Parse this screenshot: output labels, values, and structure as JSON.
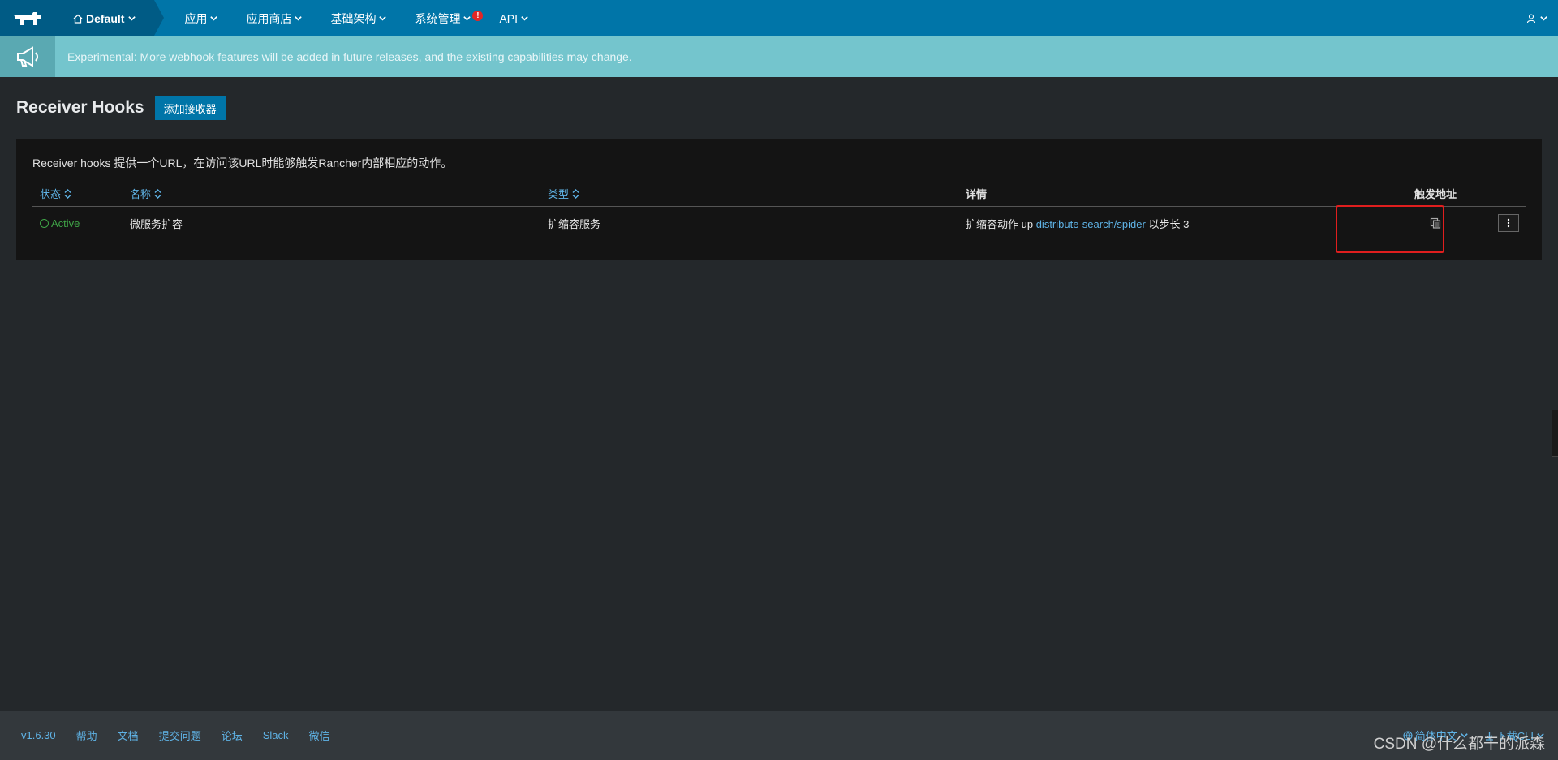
{
  "nav": {
    "env_label": "Default",
    "items": [
      {
        "label": "应用"
      },
      {
        "label": "应用商店"
      },
      {
        "label": "基础架构"
      },
      {
        "label": "系统管理",
        "alert": "!"
      },
      {
        "label": "API"
      }
    ]
  },
  "banner": {
    "text": "Experimental: More webhook features will be added in future releases, and the existing capabilities may change."
  },
  "header": {
    "title": "Receiver Hooks",
    "add_button": "添加接收器"
  },
  "card": {
    "description": "Receiver hooks 提供一个URL，在访问该URL时能够触发Rancher内部相应的动作。",
    "columns": {
      "state": "状态",
      "name": "名称",
      "type": "类型",
      "detail": "详情",
      "trigger": "触发地址"
    },
    "rows": [
      {
        "state": "Active",
        "name": "微服务扩容",
        "type": "扩缩容服务",
        "detail_prefix": "扩缩容动作 up",
        "detail_link": "distribute-search/spider",
        "detail_suffix": "以步长 3"
      }
    ]
  },
  "footer": {
    "version": "v1.6.30",
    "links": [
      "帮助",
      "文档",
      "提交问题",
      "论坛",
      "Slack",
      "微信"
    ],
    "language": "简体中文",
    "download": "下载CLI"
  },
  "watermark": "CSDN @什么都干的派森",
  "colors": {
    "nav": "#0075a8",
    "banner": "#74c5cd",
    "active": "#3fa447",
    "link": "#5fb3e6",
    "highlight": "#e01e1e"
  }
}
